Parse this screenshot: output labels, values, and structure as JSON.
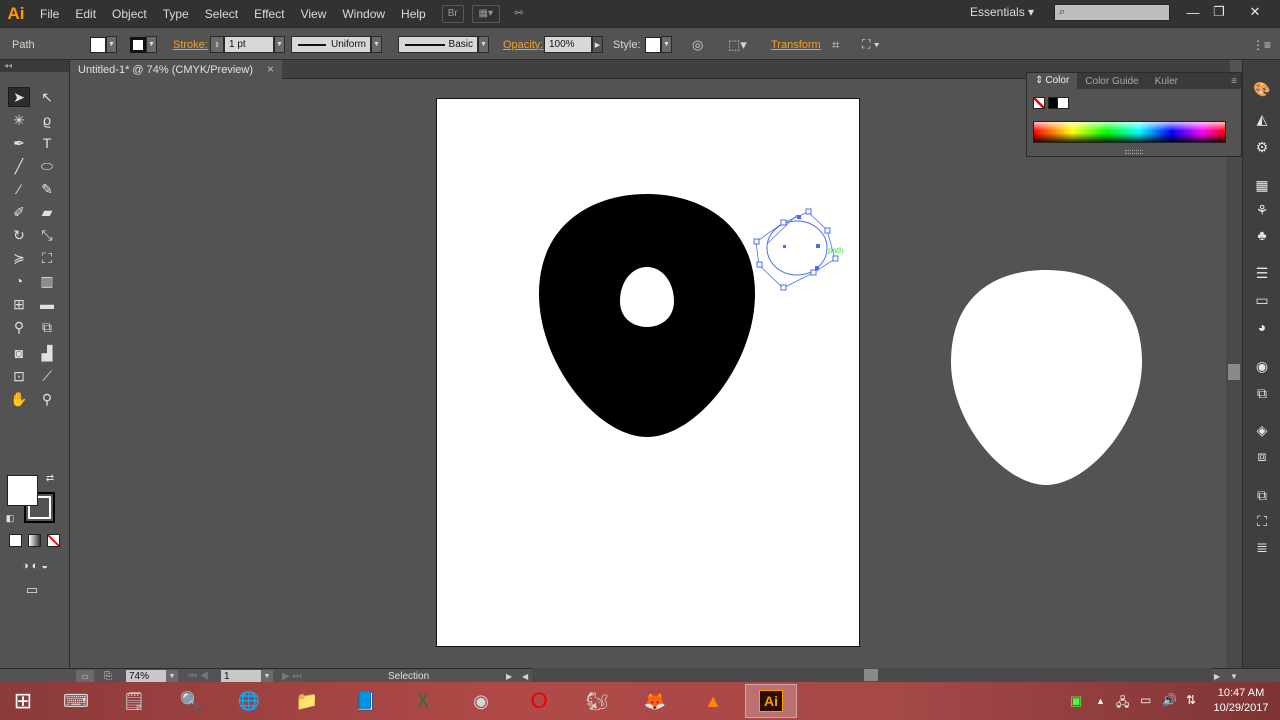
{
  "app": {
    "logo": "Ai",
    "workspace": "Essentials"
  },
  "menu": [
    "File",
    "Edit",
    "Object",
    "Type",
    "Select",
    "Effect",
    "View",
    "Window",
    "Help"
  ],
  "window_controls": {
    "minimize": "—",
    "restore": "❐",
    "close": "✕"
  },
  "control_bar": {
    "selection_type": "Path",
    "stroke_label": "Stroke:",
    "stroke_weight": "1 pt",
    "profile": "Uniform",
    "brush": "Basic",
    "opacity_label": "Opacity:",
    "opacity_value": "100%",
    "style_label": "Style:",
    "transform_label": "Transform"
  },
  "document": {
    "tab_title": "Untitled-1* @ 74% (CMYK/Preview)",
    "close": "×",
    "color_mode": "CMYK",
    "zoom": "74%"
  },
  "canvas": {
    "smart_guide_label": "path"
  },
  "color_panel": {
    "tabs": [
      "Color",
      "Color Guide",
      "Kuler"
    ],
    "active_tab": "Color"
  },
  "status_bar": {
    "zoom": "74%",
    "artboard": "1",
    "tool": "Selection"
  },
  "taskbar": {
    "time": "10:47 AM",
    "date": "10/29/2017"
  },
  "colors": {
    "accent_orange": "#f0a030",
    "selection_blue": "#4a72e8",
    "guide_green": "#3ee03e"
  }
}
